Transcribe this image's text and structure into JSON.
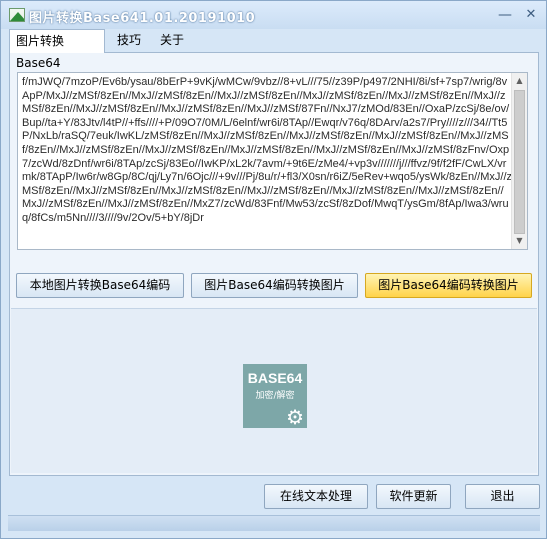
{
  "window": {
    "title": "图片转换Base641.01.20191010",
    "minimize_glyph": "—",
    "close_glyph": "✕"
  },
  "tabs": [
    {
      "label": "图片转换Base64",
      "active": true
    },
    {
      "label": "技巧",
      "active": false
    },
    {
      "label": "关于",
      "active": false
    }
  ],
  "base64_text": "f/mJWQ/7mzoP/Ev6b/ysau/8bErP+9vKj/wMCw/9vbz//8+vL///75//z39P/p497/2NHI/8i/sf+7sp7/wrig/8vApP/MxJ//zMSf/8zEn//MxJ//zMSf/8zEn//MxJ//zMSf/8zEn//MxJ//zMSf/8zEn//MxJ//zMSf/8zEn//MxJ//zMSf/8zEn//MxJ//zMSf/8zEn//MxJ//zMSf/8zEn//MxJ//zMSf/87Fn//NxJ7/zMOd/83En//OxaP/zcSj/8e/ov/Bup//ta+Y/83Jtv/l4tP//+ffs////+P/09O7/0M/L/6elnf/wr6i/8TAp//Ewqr/v76q/8DArv/a2s7/Pry////z///34//Tt5P/NxLb/raSQ/7euk/IwKL/zMSf/8zEn//MxJ//zMSf/8zEn//MxJ//zMSf/8zEn//MxJ//zMSf/8zEn//MxJ//zMSf/8zEn//MxJ//zMSf/8zEn//MxJ//zMSf/8zEn//MxJ//zMSf/8zEn//MxJ//zMSf/8zEn//MxJ//zMSf/8zFnv/Oxp7/zcWd/8zDnf/wr6i/8TAp/zcSj/83Eo//IwKP/xL2k/7avm/+9t6E/zMe4/+vp3v///////j///ffvz/9f/f2fF/CwLX/vrmk/8TApP/Iw6r/w8Gp/8C/qj/Ly7n/6Ojc///+9v///Pj/8u/r/+fl3/X0sn/r6iZ/5eRev+wqo5/ysWk/8zEn//MxJ//zMSf/8zEn//MxJ//zMSf/8zEn//MxJ//zMSf/8zEn//MxJ//zMSf/8zEn//MxJ//zMSf/8zEn//MxJ//zMSf/8zEn//MxJ//zMSf/8zEn//MxJ//zMSf/8zEn//MxZ7/zcWd/83Fnf/Mw53/zcSf/8zDof/MwqT/ysGm/8fAp/Iwa3/wruq/8fCs/m5Nn////3////9v/2Ov/5+bY/8jDr",
  "buttons": {
    "local_to_base64": "本地图片转换Base64编码",
    "image_to_base64": "图片Base64编码转换图片",
    "base64_to_image": "图片Base64编码转换图片",
    "online_text": "在线文本处理",
    "update": "软件更新",
    "exit": "退出"
  },
  "logo": {
    "line1": "BASE64",
    "line2": "加密/解密",
    "gear_icon": "gear-icon"
  },
  "scrollbar": {
    "up_glyph": "▲",
    "down_glyph": "▼"
  },
  "colors": {
    "window_bg": "#d6e6f6",
    "highlight_button": "#ffd34a",
    "logo_bg": "#7da7a8"
  }
}
